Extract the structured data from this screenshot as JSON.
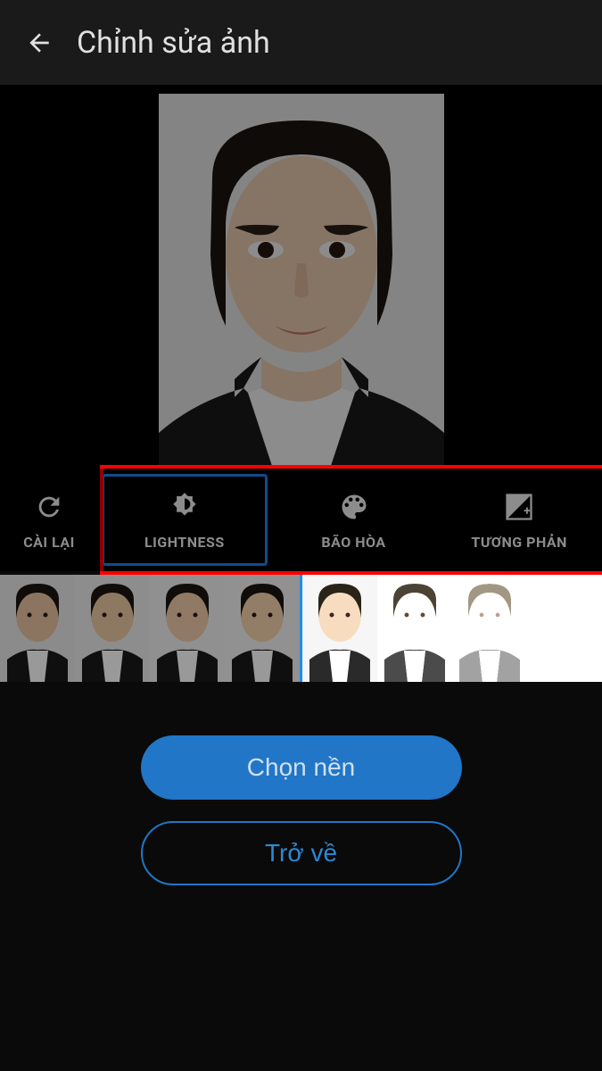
{
  "header": {
    "title": "Chỉnh sửa ảnh"
  },
  "adjust": {
    "reset": "CÀI LẠI",
    "lightness": "LIGHTNESS",
    "saturation": "BÃO HÒA",
    "contrast": "TƯƠNG PHẢN"
  },
  "buttons": {
    "choose_bg": "Chọn nền",
    "back": "Trở về"
  },
  "thumbnails": {
    "count": 8,
    "active_index": 3
  }
}
